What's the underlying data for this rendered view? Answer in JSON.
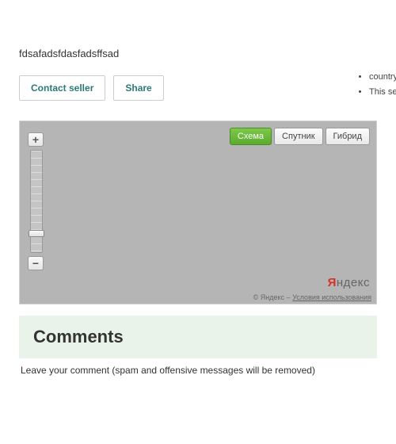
{
  "description": "fdsafadsfdasfadsffsad",
  "actions": {
    "contact": "Contact seller",
    "share": "Share"
  },
  "sidebar": {
    "items": [
      "country and travellers cheques.",
      "This service guarantees transactions; the payment for the transaction remains in service until you get protection."
    ]
  },
  "map": {
    "types": {
      "scheme": "Схема",
      "satellite": "Спутник",
      "hybrid": "Гибрид"
    },
    "logo_prefix": "Я",
    "logo_text": "ндекс",
    "copyright": "© Яндекс –",
    "terms": "Условия использования"
  },
  "comments": {
    "title": "Comments",
    "subtitle": "Leave your comment (spam and offensive messages will be removed)"
  }
}
